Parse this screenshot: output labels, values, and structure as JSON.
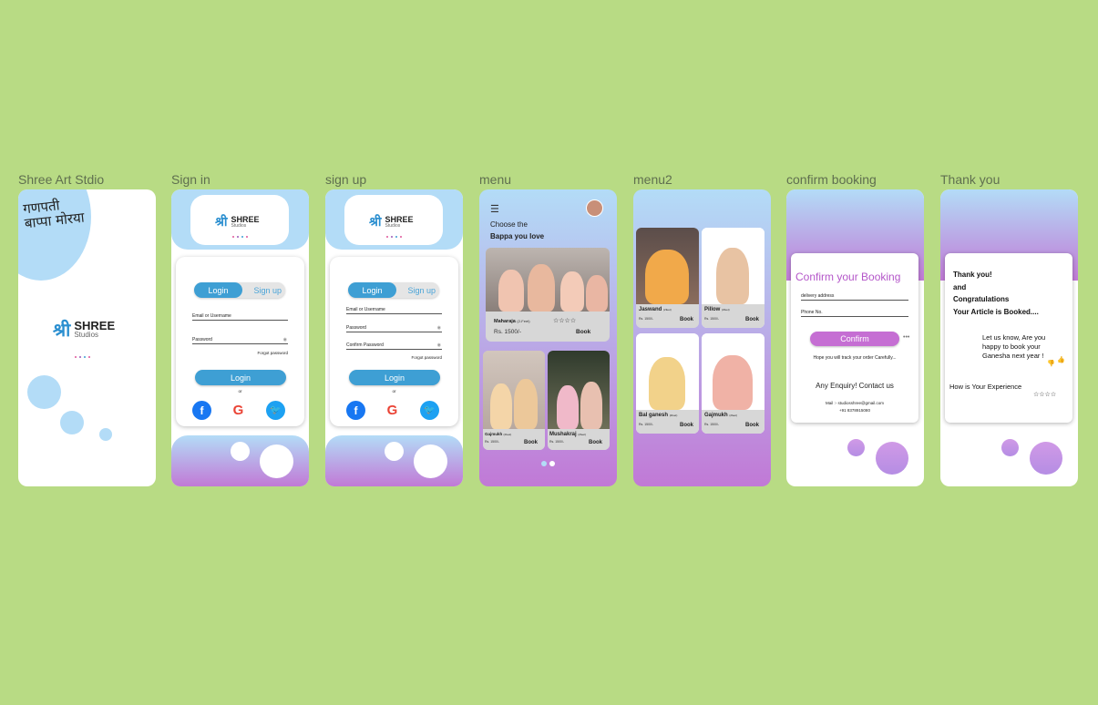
{
  "frames": [
    {
      "label": "Shree Art Stdio"
    },
    {
      "label": "Sign in"
    },
    {
      "label": "sign up"
    },
    {
      "label": "menu"
    },
    {
      "label": "menu2"
    },
    {
      "label": "confirm booking"
    },
    {
      "label": "Thank you"
    }
  ],
  "brand": {
    "glyph": "श्री",
    "name": "SHREE",
    "sub": "Studios",
    "devanagari": "गणपती बाप्पा मोरया"
  },
  "auth": {
    "login_tab": "Login",
    "signup_tab": "Sign up",
    "email_label": "Email or Username",
    "password_label": "Password",
    "confirm_password_label": "Confirm Password",
    "forgot": "Forgot password",
    "login_button": "Login",
    "or": "or"
  },
  "menu": {
    "heading_line1": "Choose the",
    "heading_line2": "Bappa you love",
    "featured": {
      "name": "Maharaja",
      "size": "(2-Feet)",
      "price": "Rs. 1500/-",
      "book": "Book"
    },
    "items": [
      {
        "name": "Gajmukh",
        "size": "(2feet)",
        "price": "Rs. 1500/-",
        "book": "Book"
      },
      {
        "name": "Mushakraj",
        "size": "(2feet)",
        "price": "Rs. 1500/-",
        "book": "Book"
      }
    ]
  },
  "menu2": {
    "items": [
      {
        "name": "Jaswand",
        "size": "(2feet)",
        "price": "Rs. 1500/-",
        "book": "Book"
      },
      {
        "name": "Pillow",
        "size": "(2feet)",
        "price": "Rs. 1500/-",
        "book": "Book"
      },
      {
        "name": "Bal ganesh",
        "size": "(2feet)",
        "price": "Rs. 1500/-",
        "book": "Book"
      },
      {
        "name": "Gajmukh",
        "size": "(2feet)",
        "price": "Rs. 1500/-",
        "book": "Book"
      }
    ]
  },
  "confirm": {
    "title": "Confirm your Booking",
    "address_placeholder": "delivery address",
    "phone_placeholder": "Phone No.",
    "button": "Confirm",
    "track": "Hope you will track your order Carefully...",
    "enquiry": "Any Enquiry! Contact us",
    "mail": "Mail :- studiosshree@gmail.com",
    "phone": "+91 8378915080"
  },
  "thanks": {
    "line1": "Thank you!",
    "line2": "and",
    "line3": "Congratulations",
    "line4": "Your Article is Booked....",
    "question": "Let us know, Are you happy to book your Ganesha next year !",
    "experience": "How is Your Experience",
    "stars": "☆☆☆☆"
  },
  "colors": {
    "accent": "#3e9fd4",
    "purple": "#c179d6",
    "light_blue": "#b3dcf7",
    "bg": "#b8db84"
  }
}
